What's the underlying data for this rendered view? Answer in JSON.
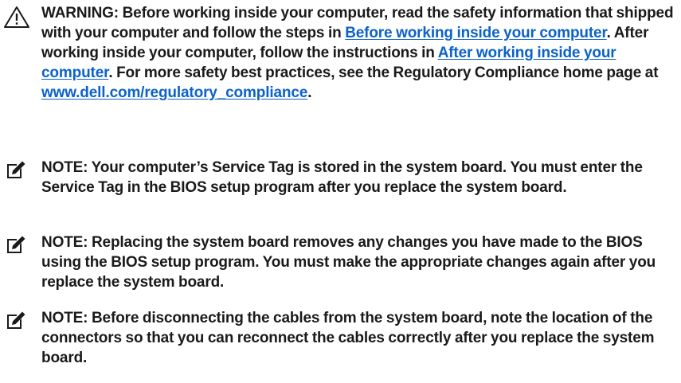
{
  "warning": {
    "icon": "warning-triangle-icon",
    "text_1": "WARNING: Before working inside your computer, read the safety information that shipped with your computer and follow the steps in ",
    "link_1": "Before working inside your computer",
    "text_2": ". After working inside your computer, follow the instructions in ",
    "link_2": "After working inside your computer",
    "text_3": ". For more safety best practices, see the Regulatory Compliance home page at ",
    "link_3": "www.dell.com/regulatory_compliance",
    "text_4": "."
  },
  "notes": [
    {
      "icon": "note-pencil-icon",
      "text": "NOTE: Your computer’s Service Tag is stored in the system board. You must enter the Service Tag in the BIOS setup program after you replace the system board."
    },
    {
      "icon": "note-pencil-icon",
      "text": "NOTE: Replacing the system board removes any changes you have made to the BIOS using the BIOS setup program. You must make the appropriate changes again after you replace the system board."
    },
    {
      "icon": "note-pencil-icon",
      "text": "NOTE: Before disconnecting the cables from the system board, note the location of the connectors so that you can reconnect the cables correctly after you replace the system board."
    }
  ],
  "colors": {
    "text": "#1a1a1a",
    "link": "#0b62c8"
  }
}
